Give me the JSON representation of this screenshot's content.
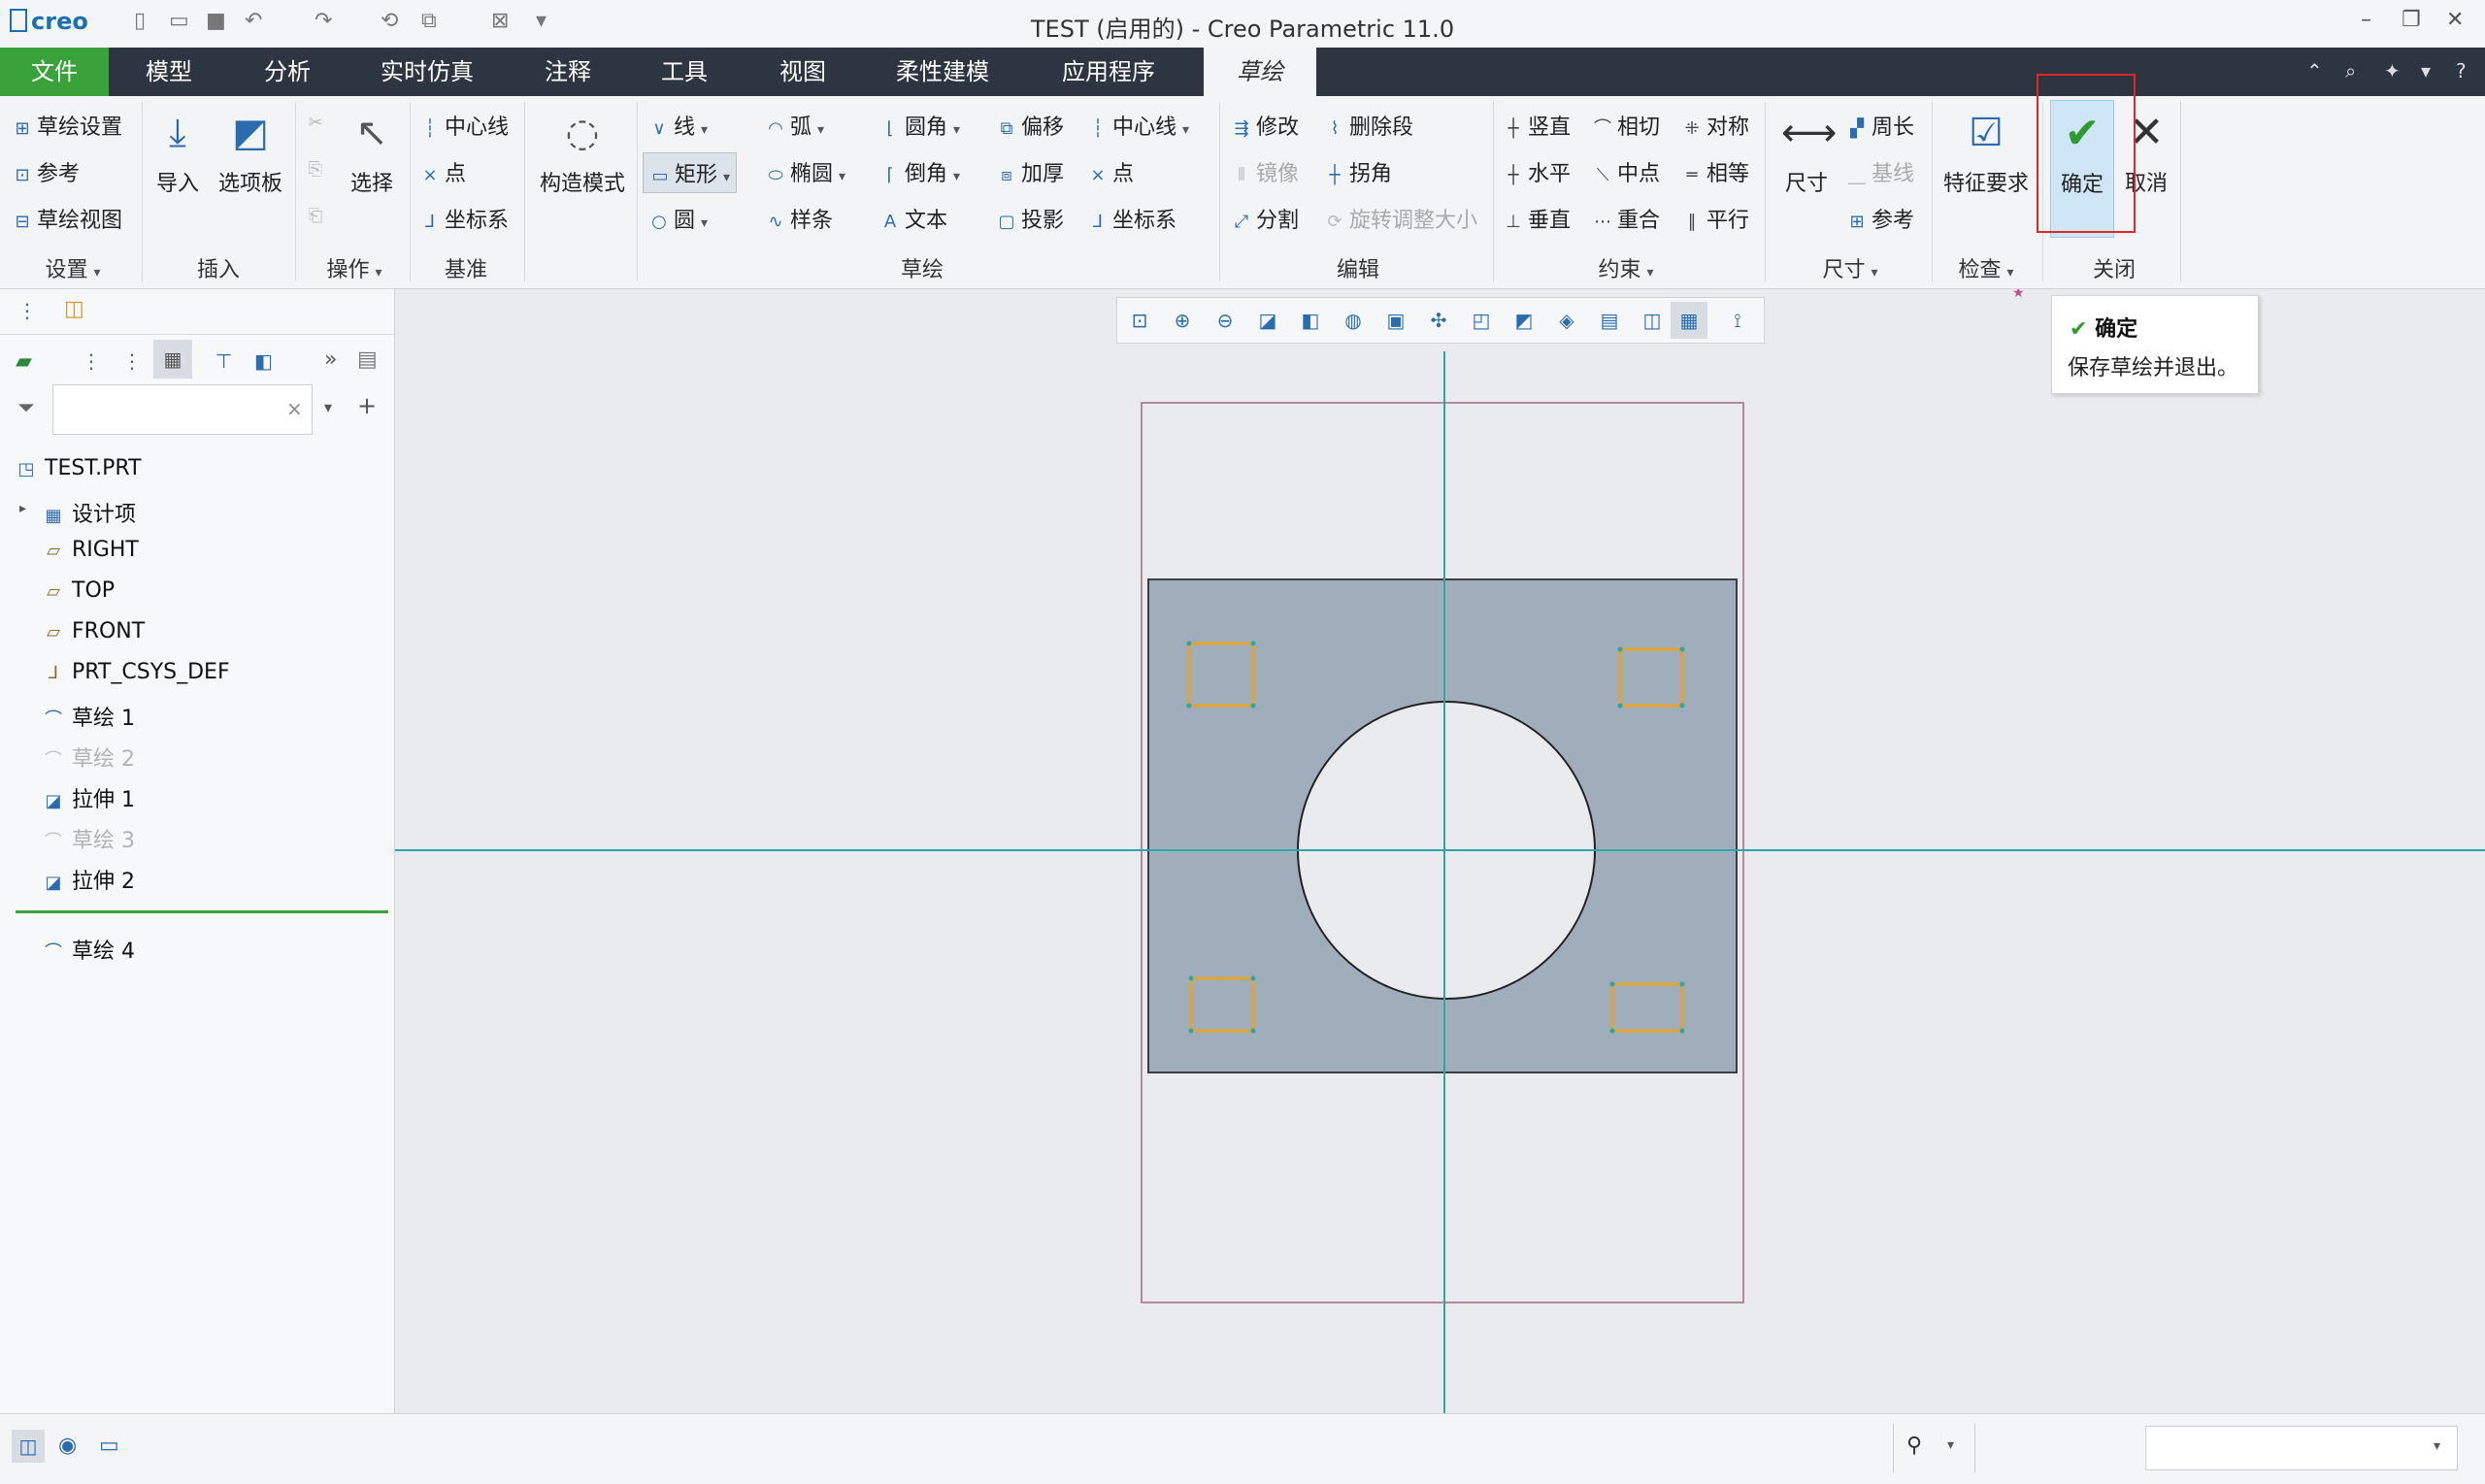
{
  "app": {
    "logo": "creo",
    "window_title": "TEST (启用的) - Creo Parametric 11.0"
  },
  "tabs": [
    "文件",
    "模型",
    "分析",
    "实时仿真",
    "注释",
    "工具",
    "视图",
    "柔性建模",
    "应用程序",
    "草绘"
  ],
  "active_tab": "草绘",
  "ribbon": {
    "settings": {
      "items": [
        "草绘设置",
        "参考",
        "草绘视图"
      ],
      "label": "设置"
    },
    "insert": {
      "items": [
        "导入",
        "选项板"
      ],
      "label": "插入"
    },
    "operations": {
      "items": [
        "选择"
      ],
      "label": "操作"
    },
    "datum": {
      "items": [
        "中心线",
        "点",
        "坐标系"
      ],
      "label": "基准"
    },
    "construction": "构造模式",
    "sketch": {
      "col1": [
        "线",
        "矩形",
        "圆"
      ],
      "col2": [
        "弧",
        "椭圆",
        "样条"
      ],
      "col3": [
        "圆角",
        "倒角",
        "文本"
      ],
      "col4": [
        "偏移",
        "加厚",
        "投影"
      ],
      "col5": [
        "中心线",
        "点",
        "坐标系"
      ],
      "label": "草绘"
    },
    "edit": {
      "items": [
        "修改",
        "删除段",
        "镜像",
        "拐角",
        "分割",
        "旋转调整大小"
      ],
      "label": "编辑"
    },
    "constrain": {
      "items": [
        "竖直",
        "相切",
        "对称",
        "水平",
        "中点",
        "相等",
        "垂直",
        "重合",
        "平行"
      ],
      "label": "约束"
    },
    "dimension": {
      "items": [
        "尺寸",
        "周长",
        "基线",
        "参考"
      ],
      "label": "尺寸"
    },
    "inspect": {
      "items": [
        "特征要求"
      ],
      "label": "检查"
    },
    "close": {
      "ok": "确定",
      "cancel": "取消",
      "label": "关闭"
    }
  },
  "tooltip": {
    "title": "确定",
    "desc": "保存草绘并退出。"
  },
  "model_tree": [
    {
      "label": "TEST.PRT",
      "icon": "part-icon",
      "dim": false
    },
    {
      "label": "设计项",
      "icon": "design-items-icon",
      "dim": false
    },
    {
      "label": "RIGHT",
      "icon": "datum-plane-icon",
      "dim": false
    },
    {
      "label": "TOP",
      "icon": "datum-plane-icon",
      "dim": false
    },
    {
      "label": "FRONT",
      "icon": "datum-plane-icon",
      "dim": false
    },
    {
      "label": "PRT_CSYS_DEF",
      "icon": "csys-icon",
      "dim": false
    },
    {
      "label": "草绘 1",
      "icon": "sketch-icon",
      "dim": false
    },
    {
      "label": "草绘 2",
      "icon": "sketch-icon",
      "dim": true
    },
    {
      "label": "拉伸 1",
      "icon": "extrude-icon",
      "dim": false
    },
    {
      "label": "草绘 3",
      "icon": "sketch-icon",
      "dim": true
    },
    {
      "label": "拉伸 2",
      "icon": "extrude-icon",
      "dim": false
    },
    {
      "label": "草绘 4",
      "icon": "sketch-icon",
      "dim": false
    }
  ],
  "colors": {
    "file_tab": "#3aa23a",
    "tabbar": "#2d3640",
    "plate": "#a0adbb",
    "centerline": "#2aa7a7",
    "sketch_rect": "#e5a52b",
    "highlight": "#e0282c"
  }
}
